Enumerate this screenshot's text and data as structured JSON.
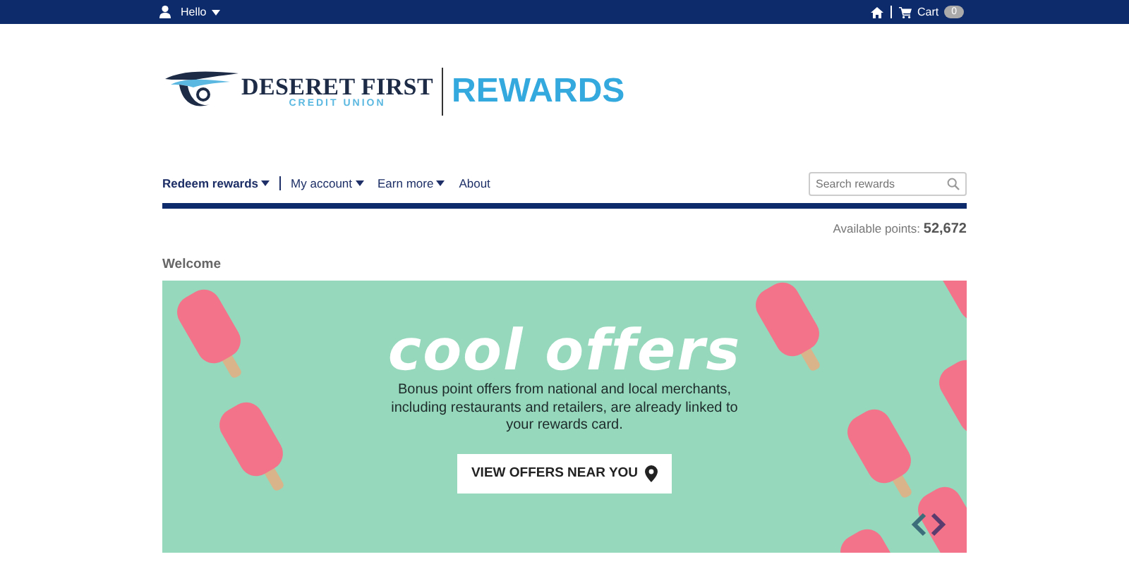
{
  "top_bar": {
    "user_menu": "Hello",
    "cart": {
      "label": "Cart",
      "count": "0"
    }
  },
  "logo": {
    "name": "DESERET FIRST",
    "subtitle": "CREDIT UNION",
    "program": "REWARDS"
  },
  "nav": {
    "items": [
      {
        "label": "Redeem rewards",
        "dropdown": true,
        "selected": true
      },
      {
        "label": "My account",
        "dropdown": true,
        "selected": false
      },
      {
        "label": "Earn more",
        "dropdown": true,
        "selected": false
      },
      {
        "label": "About",
        "dropdown": false,
        "selected": false
      }
    ],
    "search": {
      "placeholder": "Search rewards"
    }
  },
  "points": {
    "label": "Available points:",
    "value": "52,672"
  },
  "section_title": "Welcome",
  "banner": {
    "kind": "picture",
    "headline": "cool offers",
    "body": "Bonus point offers from national and local merchants, including restaurants and retailers, are already linked to your rewards card.",
    "button": "VIEW OFFERS NEAR YOU"
  }
}
